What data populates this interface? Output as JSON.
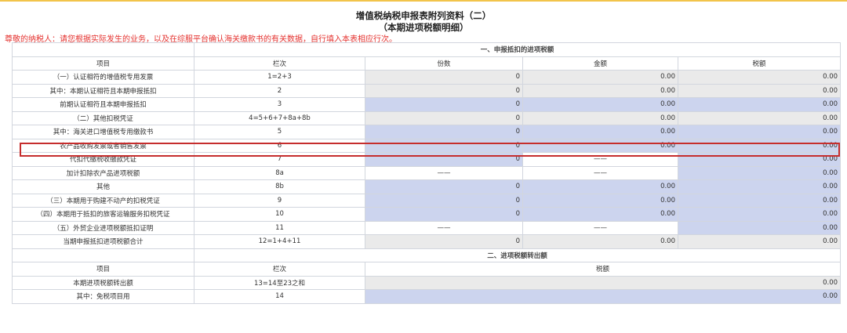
{
  "form": {
    "title_line1": "增值税纳税申报表附列资料（二）",
    "title_line2": "（本期进项税额明细）",
    "notice": "尊敬的纳税人：请您根据实际发生的业务，以及在综服平台确认海关缴款书的有关数据，自行填入本表相应行次。"
  },
  "section1": {
    "title": "一、申报抵扣的进项税额",
    "headers": [
      "项目",
      "栏次",
      "份数",
      "金额",
      "税额"
    ],
    "rows": [
      {
        "label": "（一）认证相符的增值税专用发票",
        "code": "1=2+3",
        "count": "0",
        "amount": "0.00",
        "tax": "0.00"
      },
      {
        "label": "其中：本期认证相符且本期申报抵扣",
        "code": "2",
        "count": "0",
        "amount": "0.00",
        "tax": "0.00"
      },
      {
        "label": "前期认证相符且本期申报抵扣",
        "code": "3",
        "count": "0",
        "amount": "0.00",
        "tax": "0.00"
      },
      {
        "label": "（二）其他扣税凭证",
        "code": "4=5+6+7+8a+8b",
        "count": "0",
        "amount": "0.00",
        "tax": "0.00"
      },
      {
        "label": "其中：海关进口增值税专用缴款书",
        "code": "5",
        "count": "0",
        "amount": "0.00",
        "tax": "0.00"
      },
      {
        "label": "农产品收购发票或者销售发票",
        "code": "6",
        "count": "0",
        "amount": "0.00",
        "tax": "0.00"
      },
      {
        "label": "代扣代缴税收缴款凭证",
        "code": "7",
        "count": "0",
        "amount": "——",
        "tax": "0.00"
      },
      {
        "label": "加计扣除农产品进项税额",
        "code": "8a",
        "count": "——",
        "amount": "——",
        "tax": "0.00"
      },
      {
        "label": "其他",
        "code": "8b",
        "count": "0",
        "amount": "0.00",
        "tax": "0.00"
      },
      {
        "label": "（三）本期用于购建不动产的扣税凭证",
        "code": "9",
        "count": "0",
        "amount": "0.00",
        "tax": "0.00"
      },
      {
        "label": "（四）本期用于抵扣的旅客运输服务扣税凭证",
        "code": "10",
        "count": "0",
        "amount": "0.00",
        "tax": "0.00"
      },
      {
        "label": "（五）外贸企业进项税额抵扣证明",
        "code": "11",
        "count": "——",
        "amount": "——",
        "tax": "0.00"
      },
      {
        "label": "当期申报抵扣进项税额合计",
        "code": "12=1+4+11",
        "count": "0",
        "amount": "0.00",
        "tax": "0.00"
      }
    ]
  },
  "section2": {
    "title": "二、进项税额转出额",
    "headers": [
      "项目",
      "栏次",
      "税额"
    ],
    "rows": [
      {
        "label": "本期进项税额转出额",
        "code": "13=14至23之和",
        "tax": "0.00"
      },
      {
        "label": "其中：免税项目用",
        "code": "14",
        "tax": "0.00"
      }
    ]
  },
  "colors": {
    "accent": "#f2c44a",
    "notice_red": "#e4312e",
    "highlight_border": "#c62d2d",
    "computed_cell": "#eaeaea",
    "input_cell": "#ccd4ee"
  }
}
